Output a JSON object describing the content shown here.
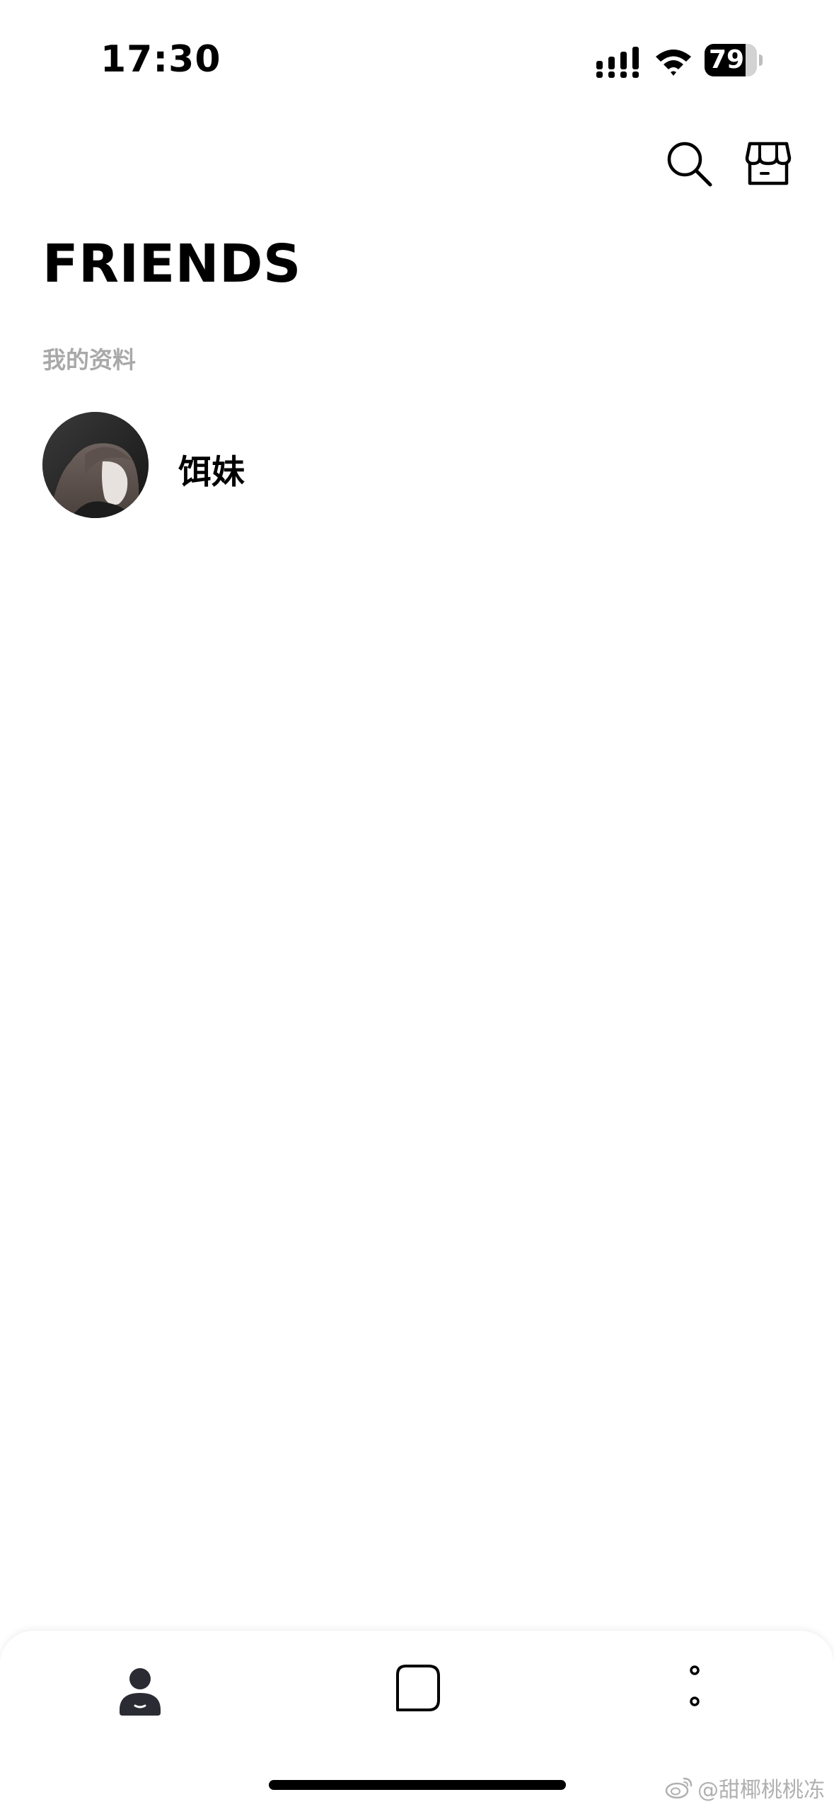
{
  "status_bar": {
    "time": "17:30",
    "battery_level": "79",
    "battery_fraction": 0.79
  },
  "header": {
    "title": "FRIENDS",
    "icons": [
      "search-icon",
      "shop-icon"
    ]
  },
  "profile_section": {
    "label": "我的资料",
    "name": "饵妹"
  },
  "tab_bar": {
    "tabs": [
      {
        "id": "friends",
        "icon": "person-icon",
        "active": true
      },
      {
        "id": "chats",
        "icon": "chat-bubble-icon",
        "active": false
      },
      {
        "id": "more",
        "icon": "more-icon",
        "active": false
      }
    ]
  },
  "watermark": {
    "text": "@甜椰桃桃冻"
  },
  "colors": {
    "background": "#ffffff",
    "title_text": "#000000",
    "section_label": "#a9a9a9",
    "tab_active": "#2b2b33"
  }
}
